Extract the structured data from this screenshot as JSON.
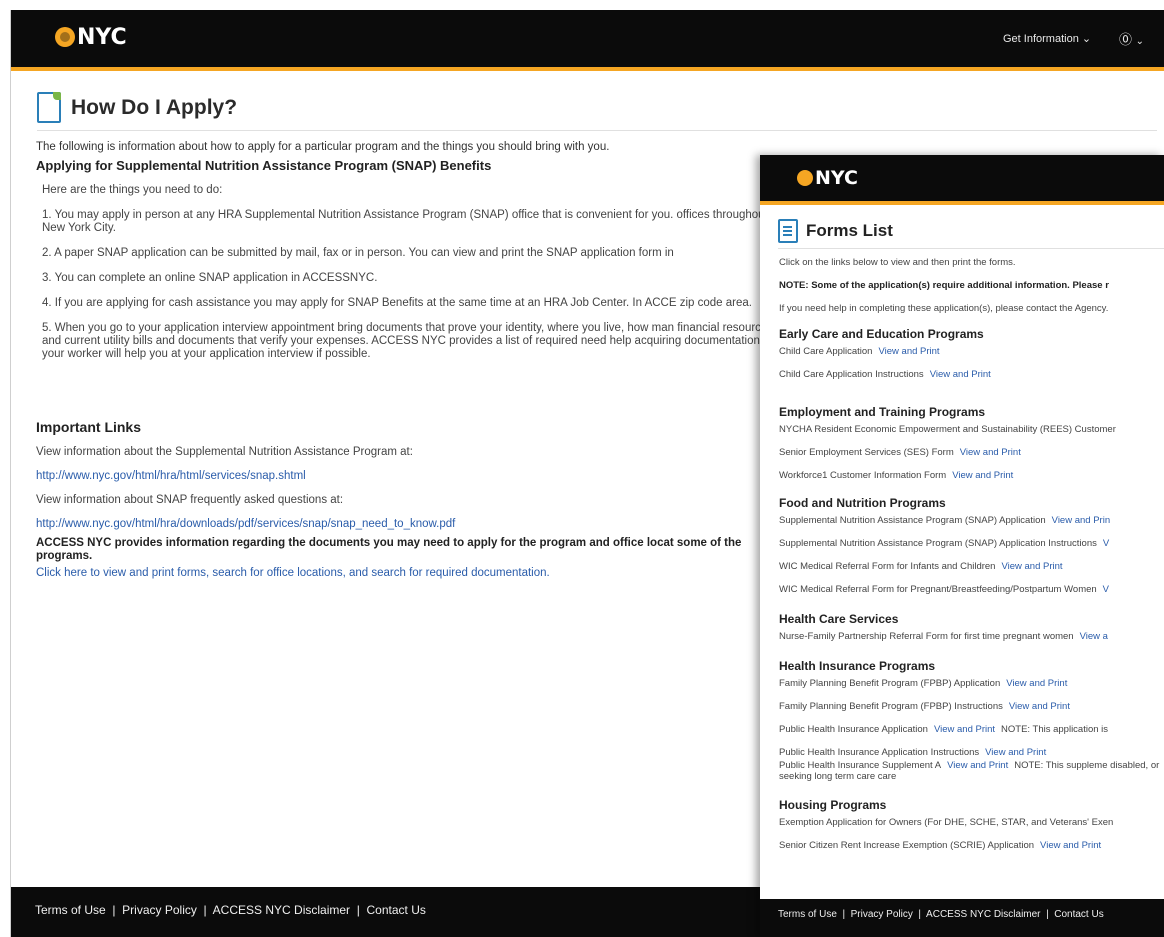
{
  "main": {
    "logo_text": "NYC",
    "nav": {
      "get_info": "Get Information",
      "help_icon": "question-circle-icon"
    },
    "page_title": "How Do I Apply?",
    "intro": "The following is information about how to apply for a particular program and the things you should bring with you.",
    "section_title": "Applying for Supplemental Nutrition Assistance Program (SNAP) Benefits",
    "paragraphs": [
      "Here are the things you need to do:",
      "1. You may apply in person at any HRA Supplemental Nutrition Assistance Program (SNAP) office that is convenient for you. offices throughout New York City.",
      "2. A paper SNAP application can be submitted by mail, fax or in person. You can view and print the SNAP application form in",
      "3. You can complete an online SNAP application in ACCESSNYC.",
      "4. If you are applying for cash assistance you may apply for SNAP Benefits at the same time at an HRA Job Center. In ACCE zip code area.",
      "5. When you go to your application interview appointment bring documents that prove your identity, where you live, how man financial resources and current utility bills and documents that verify your expenses. ACCESS NYC provides a list of required need help acquiring documentation your worker will help you at your application interview if possible."
    ],
    "important_links_title": "Important Links",
    "links": {
      "snap_info_text": "View information about the Supplemental Nutrition Assistance Program at:",
      "snap_info_url": "http://www.nyc.gov/html/hra/html/services/snap.shtml",
      "faq_text": "View information about SNAP frequently asked questions at:",
      "faq_url": "http://www.nyc.gov/html/hra/downloads/pdf/services/snap/snap_need_to_know.pdf",
      "access_note": "ACCESS NYC provides information regarding the documents you may need to apply for the program and office locat some of the programs.",
      "click_here": "Click here to view and print forms, search for office locations, and search for required documentation."
    },
    "footer": [
      "Terms of Use",
      "Privacy Policy",
      "ACCESS NYC Disclaimer",
      "Contact Us"
    ]
  },
  "overlay": {
    "logo_text": "NYC",
    "title": "Forms List",
    "instructions": "Click on the links below to view and then print the forms.",
    "note": "NOTE: Some of the application(s) require additional information. Please r",
    "help": "If you need help in completing these application(s), please contact the Agency.",
    "view_print": "View and Print",
    "categories": [
      {
        "name": "Early Care and Education Programs",
        "items": [
          {
            "label": "Child Care Application",
            "link": "View and Print",
            "extra": ""
          },
          {
            "label": "Child Care Application Instructions",
            "link": "View and Print",
            "extra": ""
          }
        ]
      },
      {
        "name": "Employment and Training Programs",
        "items": [
          {
            "label": "NYCHA Resident Economic Empowerment and Sustainability (REES) Customer",
            "link": "",
            "extra": ""
          },
          {
            "label": "Senior Employment Services (SES) Form",
            "link": "View and Print",
            "extra": ""
          },
          {
            "label": "Workforce1 Customer Information Form",
            "link": "View and Print",
            "extra": ""
          }
        ]
      },
      {
        "name": "Food and Nutrition Programs",
        "items": [
          {
            "label": "Supplemental Nutrition Assistance Program (SNAP) Application",
            "link": "View and Prin",
            "extra": ""
          },
          {
            "label": "Supplemental Nutrition Assistance Program (SNAP) Application Instructions",
            "link": "V",
            "extra": ""
          },
          {
            "label": "WIC Medical Referral Form for Infants and Children",
            "link": "View and Print",
            "extra": ""
          },
          {
            "label": "WIC Medical Referral Form for Pregnant/Breastfeeding/Postpartum Women",
            "link": "V",
            "extra": ""
          }
        ]
      },
      {
        "name": "Health Care Services",
        "items": [
          {
            "label": "Nurse-Family Partnership Referral Form for first time pregnant women",
            "link": "View a",
            "extra": ""
          }
        ]
      },
      {
        "name": "Health Insurance Programs",
        "items": [
          {
            "label": "Family Planning Benefit Program (FPBP) Application",
            "link": "View and Print",
            "extra": ""
          },
          {
            "label": "Family Planning Benefit Program (FPBP) Instructions",
            "link": "View and Print",
            "extra": ""
          },
          {
            "label": "Public Health Insurance Application",
            "link": "View and Print",
            "extra": "NOTE: This application is"
          },
          {
            "label": "Public Health Insurance Application Instructions",
            "link": "View and Print",
            "extra": ""
          },
          {
            "label": "Public Health Insurance Supplement A",
            "link": "View and Print",
            "extra": "NOTE: This suppleme disabled, or seeking long term care care"
          }
        ]
      },
      {
        "name": "Housing Programs",
        "items": [
          {
            "label": "Exemption Application for Owners (For DHE, SCHE, STAR, and Veterans' Exen",
            "link": "",
            "extra": ""
          },
          {
            "label": "Senior Citizen Rent Increase Exemption (SCRIE) Application",
            "link": "View and Print",
            "extra": ""
          }
        ]
      }
    ],
    "footer": [
      "Terms of Use",
      "Privacy Policy",
      "ACCESS NYC Disclaimer",
      "Contact Us"
    ]
  }
}
